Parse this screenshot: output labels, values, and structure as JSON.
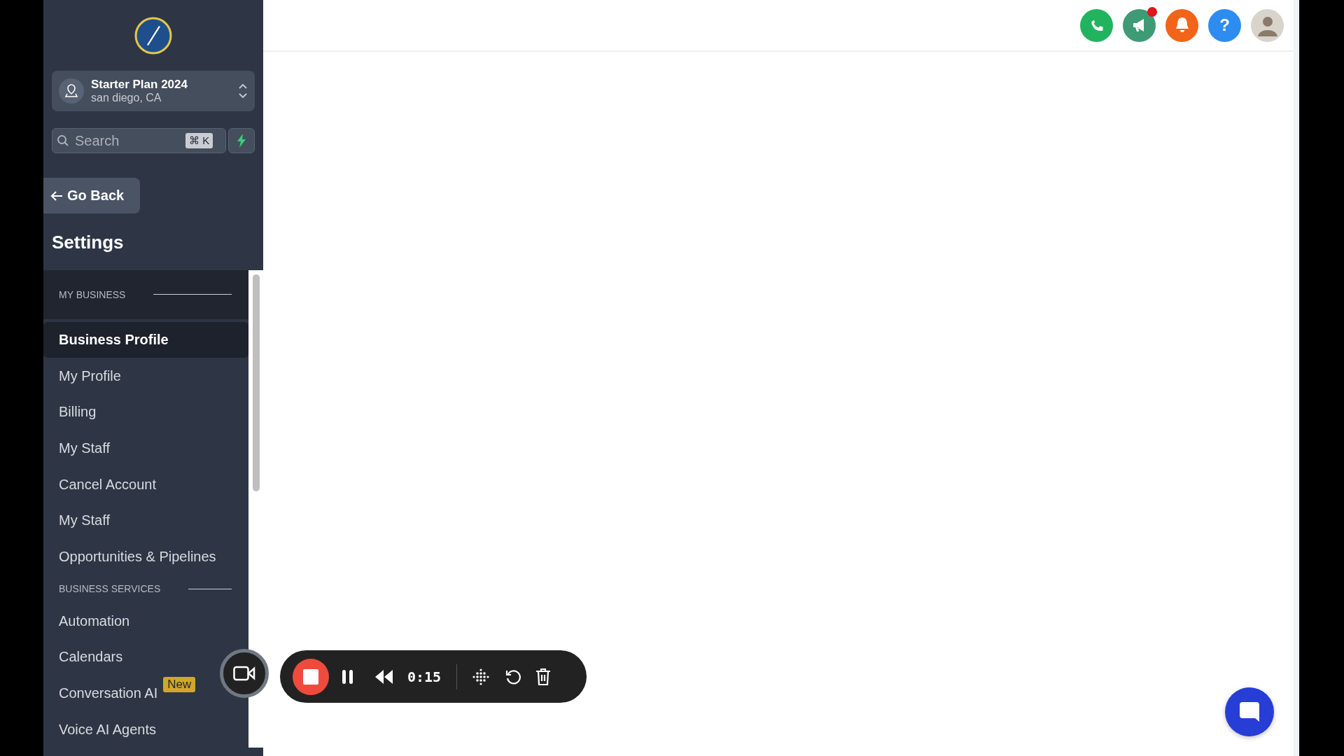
{
  "account": {
    "name": "Starter Plan 2024",
    "location": "san diego, CA"
  },
  "search": {
    "placeholder": "Search",
    "shortcut": "⌘ K"
  },
  "back_button": "Go Back",
  "settings_title": "Settings",
  "sections": [
    {
      "heading": "MY BUSINESS",
      "items": [
        {
          "label": "Business Profile",
          "selected": true
        },
        {
          "label": "My Profile",
          "selected": false
        },
        {
          "label": "Billing",
          "selected": false
        },
        {
          "label": "My Staff",
          "selected": false
        },
        {
          "label": "Cancel Account",
          "selected": false
        },
        {
          "label": "My Staff",
          "selected": false
        },
        {
          "label": "Opportunities & Pipelines",
          "selected": false
        }
      ]
    },
    {
      "heading": "BUSINESS SERVICES",
      "items": [
        {
          "label": "Automation",
          "selected": false
        },
        {
          "label": "Calendars",
          "selected": false
        },
        {
          "label": "Conversation AI",
          "selected": false,
          "badge": "New"
        },
        {
          "label": "Voice AI Agents",
          "selected": false
        }
      ]
    }
  ],
  "header_icons": [
    {
      "kind": "phone",
      "color": "#22b35e",
      "notification": false
    },
    {
      "kind": "megaphone",
      "color": "#3f9a76",
      "notification": true
    },
    {
      "kind": "bell",
      "color": "#f26419",
      "notification": false
    },
    {
      "kind": "help",
      "color": "#2d8cf0",
      "notification": false,
      "glyph": "?"
    },
    {
      "kind": "avatar",
      "color": "#d8d4cc",
      "notification": false
    }
  ],
  "recorder": {
    "time": "0:15"
  }
}
